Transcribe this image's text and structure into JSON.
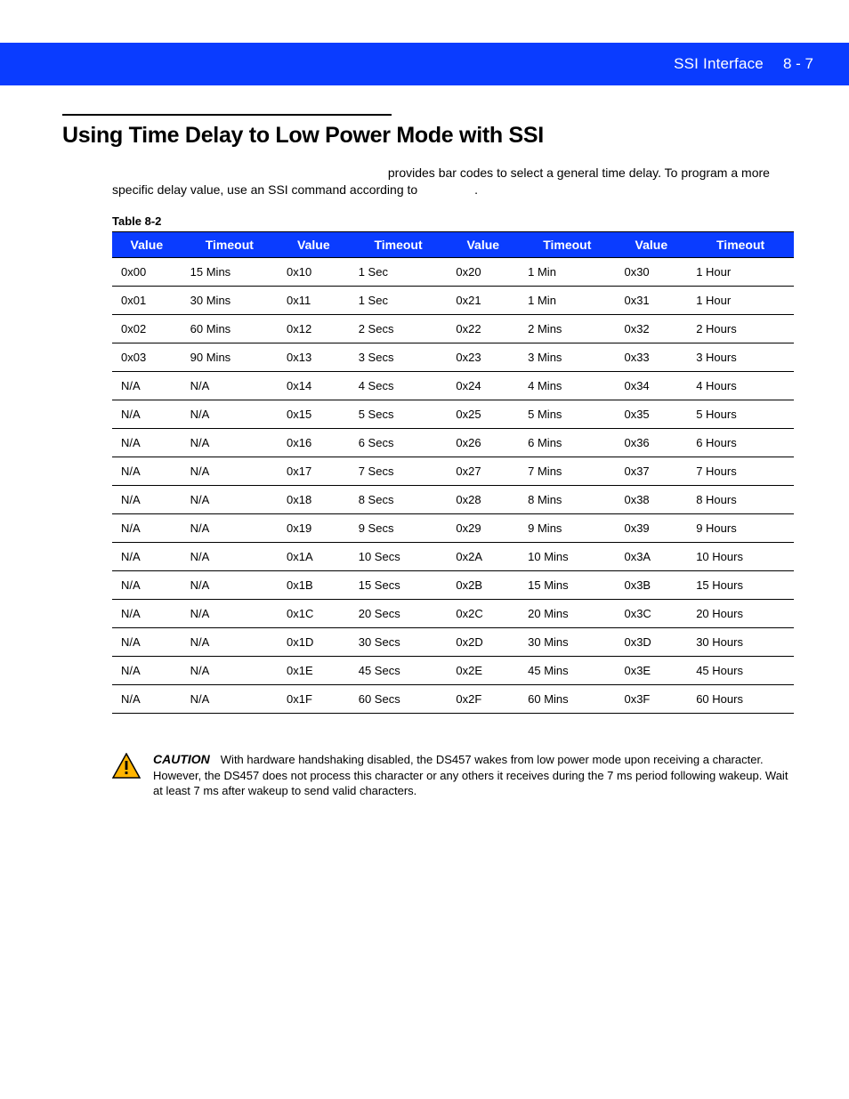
{
  "header": {
    "chapter": "SSI Interface",
    "page_label": "8 - 7"
  },
  "section": {
    "title": "Using Time Delay to Low Power Mode with SSI",
    "intro_tail": "provides bar codes to select a general time delay. To program a more specific delay value, use an SSI command according to",
    "intro_end_punct": "."
  },
  "table": {
    "label": "Table 8-2",
    "headers": [
      "Value",
      "Timeout",
      "Value",
      "Timeout",
      "Value",
      "Timeout",
      "Value",
      "Timeout"
    ],
    "rows": [
      [
        "0x00",
        "15 Mins",
        "0x10",
        "1 Sec",
        "0x20",
        "1 Min",
        "0x30",
        "1 Hour"
      ],
      [
        "0x01",
        "30 Mins",
        "0x11",
        "1 Sec",
        "0x21",
        "1 Min",
        "0x31",
        "1 Hour"
      ],
      [
        "0x02",
        "60 Mins",
        "0x12",
        "2 Secs",
        "0x22",
        "2 Mins",
        "0x32",
        "2 Hours"
      ],
      [
        "0x03",
        "90 Mins",
        "0x13",
        "3 Secs",
        "0x23",
        "3 Mins",
        "0x33",
        "3 Hours"
      ],
      [
        "N/A",
        "N/A",
        "0x14",
        "4 Secs",
        "0x24",
        "4 Mins",
        "0x34",
        "4 Hours"
      ],
      [
        "N/A",
        "N/A",
        "0x15",
        "5 Secs",
        "0x25",
        "5 Mins",
        "0x35",
        "5 Hours"
      ],
      [
        "N/A",
        "N/A",
        "0x16",
        "6 Secs",
        "0x26",
        "6 Mins",
        "0x36",
        "6 Hours"
      ],
      [
        "N/A",
        "N/A",
        "0x17",
        "7 Secs",
        "0x27",
        "7 Mins",
        "0x37",
        "7 Hours"
      ],
      [
        "N/A",
        "N/A",
        "0x18",
        "8 Secs",
        "0x28",
        "8 Mins",
        "0x38",
        "8 Hours"
      ],
      [
        "N/A",
        "N/A",
        "0x19",
        "9 Secs",
        "0x29",
        "9 Mins",
        "0x39",
        "9 Hours"
      ],
      [
        "N/A",
        "N/A",
        "0x1A",
        "10 Secs",
        "0x2A",
        "10 Mins",
        "0x3A",
        "10 Hours"
      ],
      [
        "N/A",
        "N/A",
        "0x1B",
        "15 Secs",
        "0x2B",
        "15 Mins",
        "0x3B",
        "15 Hours"
      ],
      [
        "N/A",
        "N/A",
        "0x1C",
        "20 Secs",
        "0x2C",
        "20 Mins",
        "0x3C",
        "20 Hours"
      ],
      [
        "N/A",
        "N/A",
        "0x1D",
        "30 Secs",
        "0x2D",
        "30 Mins",
        "0x3D",
        "30 Hours"
      ],
      [
        "N/A",
        "N/A",
        "0x1E",
        "45 Secs",
        "0x2E",
        "45 Mins",
        "0x3E",
        "45 Hours"
      ],
      [
        "N/A",
        "N/A",
        "0x1F",
        "60 Secs",
        "0x2F",
        "60 Mins",
        "0x3F",
        "60 Hours"
      ]
    ]
  },
  "caution": {
    "badge": "CAUTION",
    "text": "With hardware handshaking disabled, the DS457 wakes from low power mode upon receiving a character. However, the DS457 does not process this character or any others it receives during the 7 ms period following wakeup. Wait at least 7 ms after wakeup to send valid characters."
  }
}
